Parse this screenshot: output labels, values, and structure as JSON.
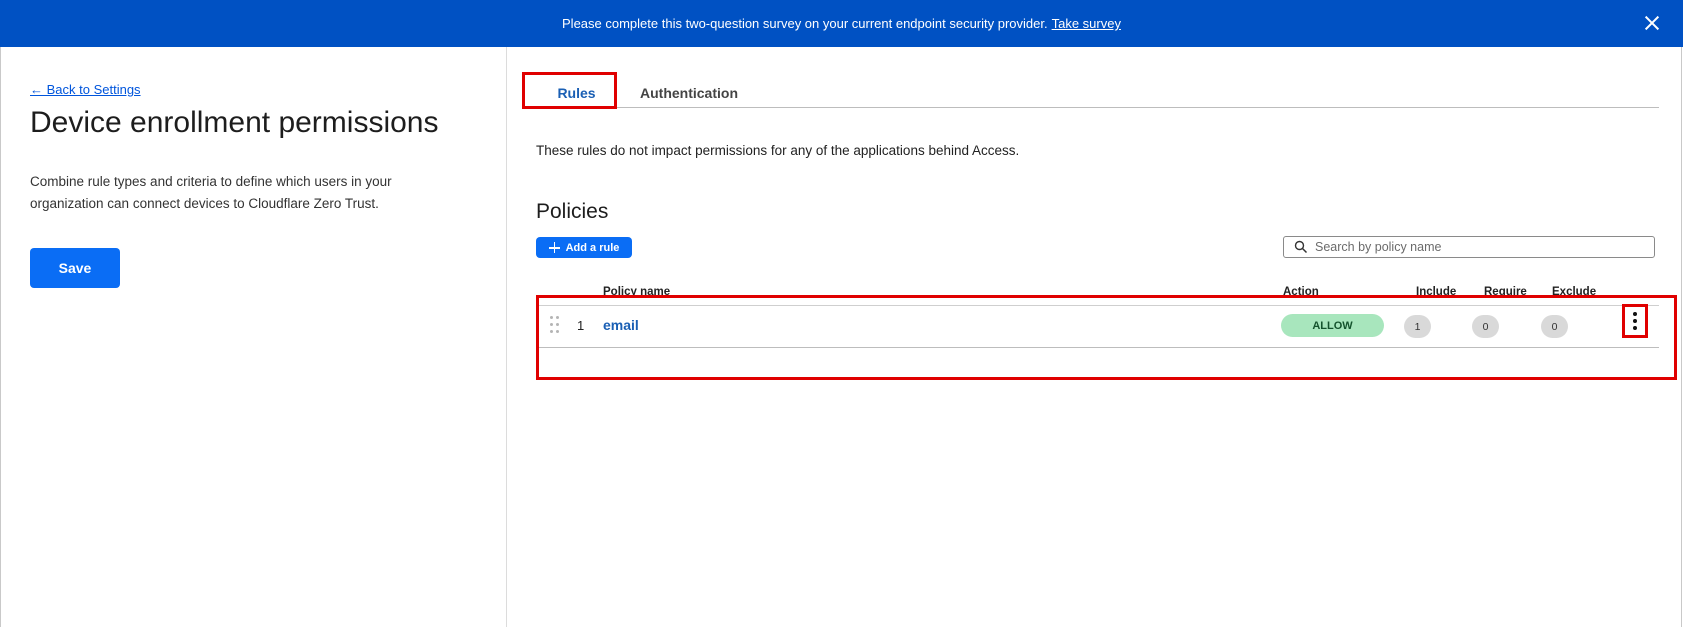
{
  "banner": {
    "message": "Please complete this two-question survey on your current endpoint security provider.",
    "link_label": "Take survey"
  },
  "sidebar": {
    "back_link": "← Back to Settings",
    "title": "Device enrollment permissions",
    "description": "Combine rule types and criteria to define which users in your organization can connect devices to Cloudflare Zero Trust.",
    "save_label": "Save"
  },
  "tabs": [
    {
      "label": "Rules",
      "active": true
    },
    {
      "label": "Authentication",
      "active": false
    }
  ],
  "main": {
    "info_text": "These rules do not impact permissions for any of the applications behind Access.",
    "policies_title": "Policies",
    "add_rule_label": "Add a rule",
    "search_placeholder": "Search by policy name"
  },
  "table": {
    "headers": {
      "policy_name": "Policy name",
      "action": "Action",
      "include": "Include",
      "require": "Require",
      "exclude": "Exclude"
    },
    "rows": [
      {
        "index": "1",
        "name": "email",
        "action": "ALLOW",
        "include": "1",
        "require": "0",
        "exclude": "0"
      }
    ]
  },
  "colors": {
    "banner": "#0051c3",
    "primary_button": "#0a6df5",
    "link": "#1a5fb4",
    "allow_badge": "#a8e6bd",
    "highlight": "#e00000"
  },
  "icons": [
    "close-icon",
    "plus-icon",
    "search-icon",
    "drag-handle-icon",
    "kebab-menu-icon"
  ]
}
